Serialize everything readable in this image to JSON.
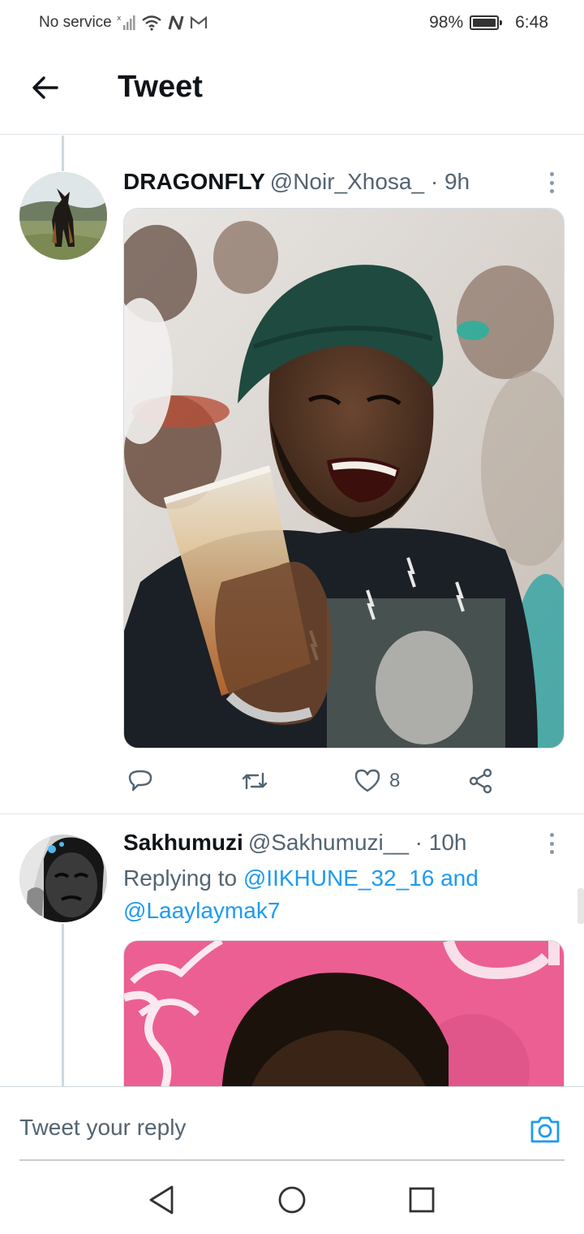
{
  "status_bar": {
    "carrier": "No service",
    "battery": "98%",
    "time": "6:48"
  },
  "header": {
    "title": "Tweet"
  },
  "tweets": [
    {
      "name": "DRAGONFLY",
      "handle": "@Noir_Xhosa_",
      "time": "· 9h",
      "likes": "8"
    },
    {
      "name": "Sakhumuzi",
      "handle": "@Sakhumuzi__",
      "time": "· 10h",
      "replying_prefix": "Replying to",
      "mention_1": "@IIKHUNE_32_16",
      "conjunction": "and",
      "mention_2": "@Laaylaymak7"
    }
  ],
  "reply_bar": {
    "placeholder": "Tweet your reply"
  },
  "colors": {
    "accent": "#1d9bf0",
    "secondary_text": "#536471"
  },
  "icons": [
    "back-arrow-icon",
    "more-vertical-icon",
    "reply-icon",
    "retweet-icon",
    "like-icon",
    "share-icon",
    "camera-icon",
    "nav-back-icon",
    "nav-home-icon",
    "nav-recents-icon"
  ]
}
